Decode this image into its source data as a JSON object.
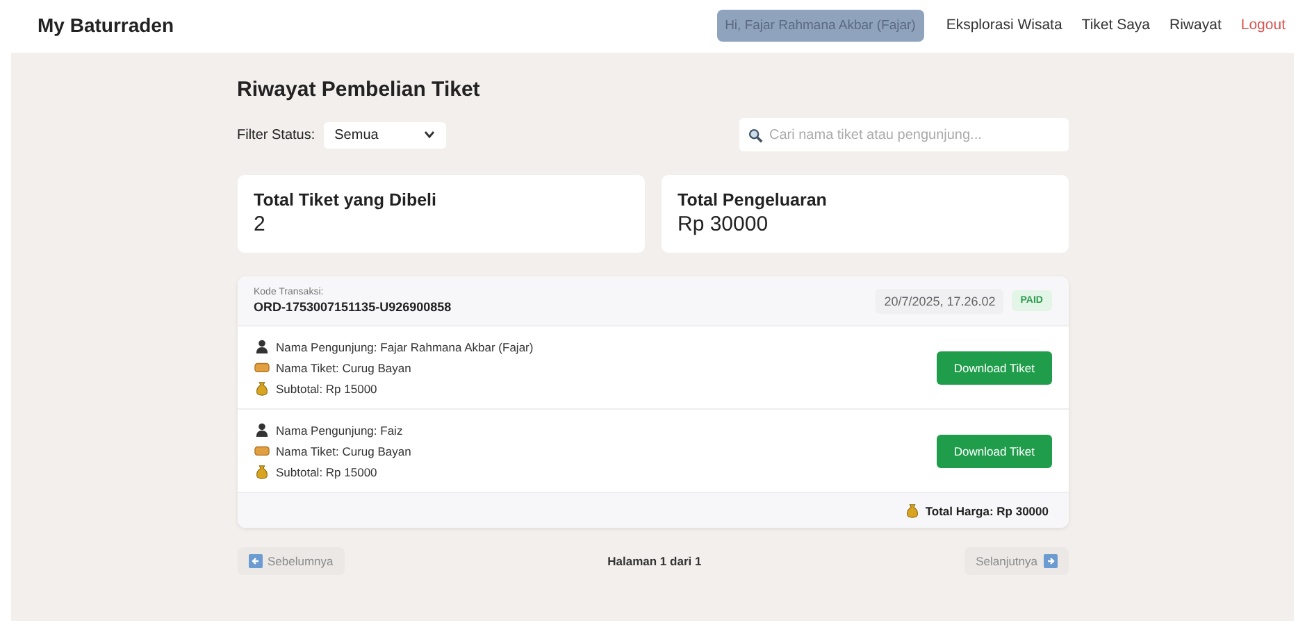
{
  "brand": "My Baturraden",
  "nav": [
    {
      "kind": "user",
      "label": "Hi, Fajar Rahmana Akbar (Fajar)"
    },
    {
      "kind": "link",
      "label": "Eksplorasi Wisata"
    },
    {
      "kind": "link",
      "label": "Tiket Saya"
    },
    {
      "kind": "link",
      "label": "Riwayat"
    },
    {
      "kind": "logout",
      "label": "Logout"
    }
  ],
  "title": "Riwayat Pembelian Tiket",
  "filter": {
    "label": "Filter Status:",
    "value": "Semua"
  },
  "search": {
    "placeholder": "Cari nama tiket atau pengunjung..."
  },
  "stats": [
    {
      "label": "Total Tiket yang Dibeli",
      "value": "2"
    },
    {
      "label": "Total Pengeluaran",
      "value": "Rp 30000"
    }
  ],
  "transactions": [
    {
      "code_label": "Kode Transaksi:",
      "code": "ORD-1753007151135-U926900858",
      "date": "20/7/2025, 17.26.02",
      "status": "PAID",
      "items": [
        {
          "visitor": "Nama Pengunjung: Fajar Rahmana Akbar (Fajar)",
          "ticket": "Nama Tiket: Curug Bayan",
          "subtotal": "Subtotal: Rp 15000",
          "button": "Download Tiket"
        },
        {
          "visitor": "Nama Pengunjung: Faiz",
          "ticket": "Nama Tiket: Curug Bayan",
          "subtotal": "Subtotal: Rp 15000",
          "button": "Download Tiket"
        }
      ],
      "total": "Total Harga: Rp 30000"
    }
  ],
  "pagination": {
    "prev": {
      "label": "Sebelumnya",
      "disabled": true
    },
    "page": "Halaman 1 dari 1",
    "next": {
      "label": "Selanjutnya",
      "disabled": true
    }
  }
}
